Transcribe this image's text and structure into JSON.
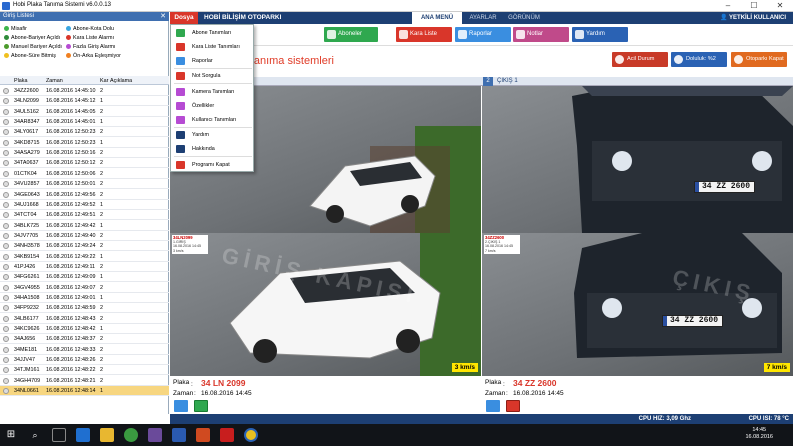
{
  "window": {
    "title": "Hobi Plaka Tanıma Sistemi  v6.0.0.13"
  },
  "legend": {
    "header": "Giriş Listesi",
    "items": [
      {
        "label": "Misafir",
        "color": "#3cb54a"
      },
      {
        "label": "Abone-Kota Dolu",
        "color": "#3aa6e0"
      },
      {
        "label": "Abone-Bariyer Açıldı",
        "color": "#2e8b3a"
      },
      {
        "label": "Kara Liste Alarmı",
        "color": "#d9362a"
      },
      {
        "label": "Manuel Bariyer Açıldı",
        "color": "#4c9b2c"
      },
      {
        "label": "Fazla Giriş Alarmı",
        "color": "#b64bd3"
      },
      {
        "label": "Abone-Süre Bitmiş",
        "color": "#f0c020"
      },
      {
        "label": "Ön-Arka Eşleşmiyor",
        "color": "#f08020"
      }
    ]
  },
  "table": {
    "columns": [
      "Plaka",
      "Zaman",
      "Kar",
      "Açıklama"
    ],
    "rows": [
      {
        "plate": "34ZZ2600",
        "time": "16.08.2016 14:45:10",
        "kar": "2",
        "desc": ""
      },
      {
        "plate": "34LN2099",
        "time": "16.08.2016 14:45:12",
        "kar": "1",
        "desc": ""
      },
      {
        "plate": "34UL5162",
        "time": "16.08.2016 14:45:05",
        "kar": "2",
        "desc": ""
      },
      {
        "plate": "34AR8347",
        "time": "16.08.2016 14:45:01",
        "kar": "1",
        "desc": ""
      },
      {
        "plate": "34LY0617",
        "time": "16.08.2016 12:50:23",
        "kar": "2",
        "desc": ""
      },
      {
        "plate": "34KD8715",
        "time": "16.08.2016 12:50:23",
        "kar": "1",
        "desc": ""
      },
      {
        "plate": "34ASA279",
        "time": "16.08.2016 12:50:16",
        "kar": "2",
        "desc": ""
      },
      {
        "plate": "34TA0637",
        "time": "16.08.2016 12:50:12",
        "kar": "2",
        "desc": ""
      },
      {
        "plate": "01CTK04",
        "time": "16.08.2016 12:50:06",
        "kar": "2",
        "desc": ""
      },
      {
        "plate": "34VU2857",
        "time": "16.08.2016 12:50:01",
        "kar": "2",
        "desc": ""
      },
      {
        "plate": "34GE0643",
        "time": "16.08.2016 12:49:56",
        "kar": "2",
        "desc": ""
      },
      {
        "plate": "34UJ1668",
        "time": "16.08.2016 12:49:52",
        "kar": "1",
        "desc": ""
      },
      {
        "plate": "34TCT04",
        "time": "16.08.2016 12:49:51",
        "kar": "2",
        "desc": ""
      },
      {
        "plate": "34BLK725",
        "time": "16.08.2016 12:49:42",
        "kar": "1",
        "desc": ""
      },
      {
        "plate": "34JV7705",
        "time": "16.08.2016 12:49:40",
        "kar": "2",
        "desc": ""
      },
      {
        "plate": "34NH3578",
        "time": "16.08.2016 12:49:24",
        "kar": "2",
        "desc": ""
      },
      {
        "plate": "34KB9154",
        "time": "16.08.2016 12:49:22",
        "kar": "1",
        "desc": ""
      },
      {
        "plate": "41PJ426",
        "time": "16.08.2016 12:49:11",
        "kar": "2",
        "desc": ""
      },
      {
        "plate": "34FG6261",
        "time": "16.08.2016 12:49:09",
        "kar": "1",
        "desc": ""
      },
      {
        "plate": "34GV4955",
        "time": "16.08.2016 12:49:07",
        "kar": "2",
        "desc": ""
      },
      {
        "plate": "34HA1508",
        "time": "16.08.2016 12:49:01",
        "kar": "1",
        "desc": ""
      },
      {
        "plate": "34FP9232",
        "time": "16.08.2016 12:48:59",
        "kar": "2",
        "desc": ""
      },
      {
        "plate": "34LB6177",
        "time": "16.08.2016 12:48:43",
        "kar": "2",
        "desc": ""
      },
      {
        "plate": "34KC9626",
        "time": "16.08.2016 12:48:42",
        "kar": "1",
        "desc": ""
      },
      {
        "plate": "34AJ656",
        "time": "16.08.2016 12:48:37",
        "kar": "2",
        "desc": ""
      },
      {
        "plate": "34ME181",
        "time": "16.08.2016 12:48:33",
        "kar": "2",
        "desc": ""
      },
      {
        "plate": "34JJV47",
        "time": "16.08.2016 12:48:26",
        "kar": "2",
        "desc": ""
      },
      {
        "plate": "34TJM161",
        "time": "16.08.2016 12:48:22",
        "kar": "2",
        "desc": ""
      },
      {
        "plate": "34GH4709",
        "time": "16.08.2016 12:48:21",
        "kar": "2",
        "desc": ""
      },
      {
        "plate": "34NL0661",
        "time": "16.08.2016 12:48:14",
        "kar": "1",
        "desc": "",
        "selected": true
      }
    ]
  },
  "header": {
    "file_menu": "Dosya",
    "brand": "HOBİ BİLİŞİM OTOPARKI",
    "tabs": [
      "ANA MENÜ",
      "AYARLAR",
      "GÖRÜNÜM"
    ],
    "user": "YETKİLİ KULLANICI"
  },
  "toolbar": {
    "buttons": [
      {
        "label": "Aboneler",
        "color": "#2fa84f"
      },
      {
        "label": "Kara Liste",
        "color": "#d9362a"
      },
      {
        "label": "Raporlar",
        "color": "#3a8ee0"
      },
      {
        "label": "Notlar",
        "color": "#c04a8a"
      },
      {
        "label": "Yardım",
        "color": "#2a62b4"
      }
    ]
  },
  "status_buttons": [
    {
      "label": "Acil Durum",
      "color": "#c83a28"
    },
    {
      "label": "Doluluk: %2",
      "color": "#2a62b4"
    },
    {
      "label": "Otoparkı Kapat",
      "color": "#e06a20"
    }
  ],
  "app_title": "aka tanıma sistemleri",
  "menu": {
    "items": [
      {
        "label": "Abone Tanımları",
        "color": "#2fa84f"
      },
      {
        "label": "Kara Liste Tanımları",
        "color": "#d9362a"
      },
      {
        "label": "Raporlar",
        "color": "#3a8ee0"
      },
      {
        "label": "Not Sorgula",
        "color": "#d9362a"
      },
      {
        "label": "Kamera Tanımları",
        "color": "#b64bd3"
      },
      {
        "label": "Özellikler",
        "color": "#b64bd3"
      },
      {
        "label": "Kullanıcı Tanımları",
        "color": "#b64bd3"
      },
      {
        "label": "Yardım",
        "color": "#1d3f73"
      },
      {
        "label": "Hakkında",
        "color": "#1d3f73"
      },
      {
        "label": "Programı Kapat",
        "color": "#d9362a"
      }
    ]
  },
  "cameras": {
    "left": {
      "watermark": "GİRİŞ KAPISI",
      "speed": "3 km/s",
      "overlay": {
        "plate": "34LN2099",
        "line1": "1.GİRİŞ",
        "line2": "16.08.2016 14:45",
        "line3": "3 km/s"
      },
      "plate_label": "Plaka",
      "plate_value": "34 LN 2099",
      "time_label": "Zaman",
      "time_value": "16.08.2016 14:45"
    },
    "right": {
      "number": "2",
      "header": "ÇIKIŞ 1",
      "watermark": "ÇIKIŞ",
      "speed": "7 km/s",
      "plate_text": "34 ZZ 2600",
      "overlay": {
        "plate": "34ZZ2600",
        "line1": "2.ÇIKIŞ 1",
        "line2": "16.08.2016 14:45",
        "line3": "7 km/s"
      },
      "plate_label": "Plaka",
      "plate_value": "34 ZZ 2600",
      "time_label": "Zaman",
      "time_value": "16.08.2016 14:45"
    }
  },
  "status": {
    "cpu_speed": "CPU HIZ: 3,09 Ghz",
    "cpu_temp": "CPU ISI: 78 °C"
  },
  "taskbar": {
    "time": "14:45",
    "date": "16.08.2016"
  }
}
